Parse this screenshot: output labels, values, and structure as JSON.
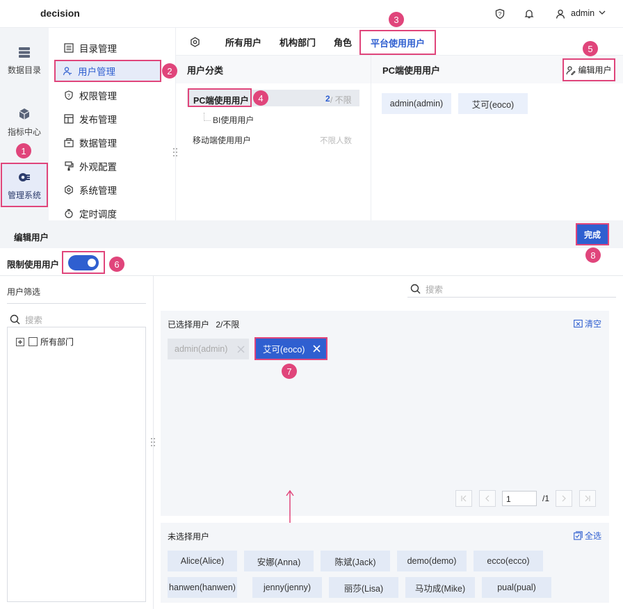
{
  "app": {
    "title": "decision",
    "user": "admin"
  },
  "rail": [
    {
      "label": "数据目录",
      "icon": "database-icon"
    },
    {
      "label": "指标中心",
      "icon": "cube-icon"
    },
    {
      "label": "管理系统",
      "icon": "gear-grid-icon"
    }
  ],
  "submenu": [
    {
      "label": "目录管理",
      "icon": "list-icon"
    },
    {
      "label": "用户管理",
      "icon": "user-icon"
    },
    {
      "label": "权限管理",
      "icon": "shield-icon"
    },
    {
      "label": "发布管理",
      "icon": "publish-icon"
    },
    {
      "label": "数据管理",
      "icon": "database-box-icon"
    },
    {
      "label": "外观配置",
      "icon": "paint-icon"
    },
    {
      "label": "系统管理",
      "icon": "settings-icon"
    },
    {
      "label": "定时调度",
      "icon": "timer-icon"
    }
  ],
  "tabs": [
    "所有用户",
    "机构部门",
    "角色",
    "平台使用用户"
  ],
  "category": {
    "title": "用户分类",
    "items": [
      {
        "label": "PC端使用用户",
        "count": "2",
        "limit": " / 不限"
      },
      {
        "label": "BI使用用户"
      },
      {
        "label": "移动端使用用户",
        "limit": "不限人数"
      }
    ]
  },
  "pc_users": {
    "title": "PC端使用用户",
    "edit_label": "编辑用户",
    "users": [
      "admin(admin)",
      "艾可(eoco)"
    ]
  },
  "edit": {
    "title": "编辑用户",
    "done_label": "完成",
    "restrict_label": "限制使用用户",
    "filter_title": "用户筛选",
    "search_placeholder": "搜索",
    "tree_root": "所有部门",
    "selected_title": "已选择用户",
    "selected_count": "2/不限",
    "clear_label": "清空",
    "selected": [
      "admin(admin)",
      "艾可(eoco)"
    ],
    "page_value": "1",
    "page_total": "/1",
    "unselected_title": "未选择用户",
    "select_all_label": "全选",
    "unselected": [
      "Alice(Alice)",
      "安娜(Anna)",
      "陈斌(Jack)",
      "demo(demo)",
      "ecco(ecco)",
      "hanwen(hanwen)",
      "jenny(jenny)",
      "丽莎(Lisa)",
      "马功成(Mike)",
      "pual(pual)"
    ]
  },
  "callouts": [
    "1",
    "2",
    "3",
    "4",
    "5",
    "6",
    "7",
    "8"
  ],
  "colors": {
    "accent": "#2f5fd0",
    "highlight": "#e0457b"
  }
}
